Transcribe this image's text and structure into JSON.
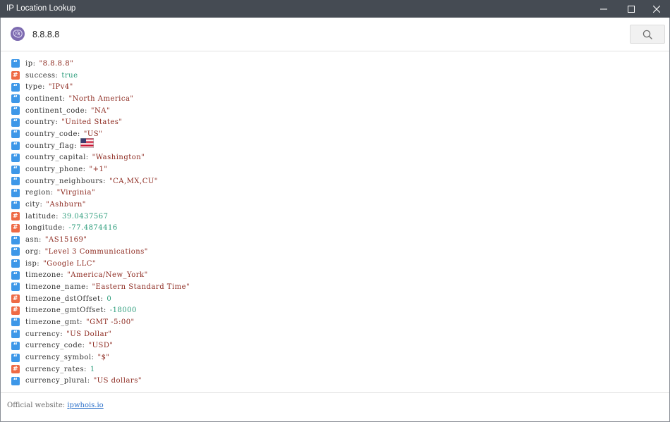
{
  "window": {
    "title": "IP Location Lookup",
    "controls": [
      "minimize",
      "maximize",
      "close"
    ]
  },
  "search": {
    "query": "8.8.8.8",
    "button_icon": "search-icon"
  },
  "colors": {
    "string_badge": "#3d97e8",
    "number_badge": "#ee6a45",
    "string_value": "#8d2a20",
    "number_value": "#2a9c7a",
    "titlebar": "#454b53"
  },
  "results": [
    {
      "key": "ip",
      "type": "string",
      "display": "\"8.8.8.8\""
    },
    {
      "key": "success",
      "type": "number",
      "display": "true"
    },
    {
      "key": "type",
      "type": "string",
      "display": "\"IPv4\""
    },
    {
      "key": "continent",
      "type": "string",
      "display": "\"North America\""
    },
    {
      "key": "continent_code",
      "type": "string",
      "display": "\"NA\""
    },
    {
      "key": "country",
      "type": "string",
      "display": "\"United States\""
    },
    {
      "key": "country_code",
      "type": "string",
      "display": "\"US\""
    },
    {
      "key": "country_flag",
      "type": "flag",
      "display": "",
      "icon": "us-flag-icon"
    },
    {
      "key": "country_capital",
      "type": "string",
      "display": "\"Washington\""
    },
    {
      "key": "country_phone",
      "type": "string",
      "display": "\"+1\""
    },
    {
      "key": "country_neighbours",
      "type": "string",
      "display": "\"CA,MX,CU\""
    },
    {
      "key": "region",
      "type": "string",
      "display": "\"Virginia\""
    },
    {
      "key": "city",
      "type": "string",
      "display": "\"Ashburn\""
    },
    {
      "key": "latitude",
      "type": "number",
      "display": "39.0437567"
    },
    {
      "key": "longitude",
      "type": "number",
      "display": "-77.4874416"
    },
    {
      "key": "asn",
      "type": "string",
      "display": "\"AS15169\""
    },
    {
      "key": "org",
      "type": "string",
      "display": "\"Level 3 Communications\""
    },
    {
      "key": "isp",
      "type": "string",
      "display": "\"Google LLC\""
    },
    {
      "key": "timezone",
      "type": "string",
      "display": "\"America/New_York\""
    },
    {
      "key": "timezone_name",
      "type": "string",
      "display": "\"Eastern Standard Time\""
    },
    {
      "key": "timezone_dstOffset",
      "type": "number",
      "display": "0"
    },
    {
      "key": "timezone_gmtOffset",
      "type": "number",
      "display": "-18000"
    },
    {
      "key": "timezone_gmt",
      "type": "string",
      "display": "\"GMT -5:00\""
    },
    {
      "key": "currency",
      "type": "string",
      "display": "\"US Dollar\""
    },
    {
      "key": "currency_code",
      "type": "string",
      "display": "\"USD\""
    },
    {
      "key": "currency_symbol",
      "type": "string",
      "display": "\"$\""
    },
    {
      "key": "currency_rates",
      "type": "number",
      "display": "1"
    },
    {
      "key": "currency_plural",
      "type": "string",
      "display": "\"US dollars\""
    }
  ],
  "footer": {
    "label": "Official website:",
    "link_text": "ipwhois.io"
  }
}
